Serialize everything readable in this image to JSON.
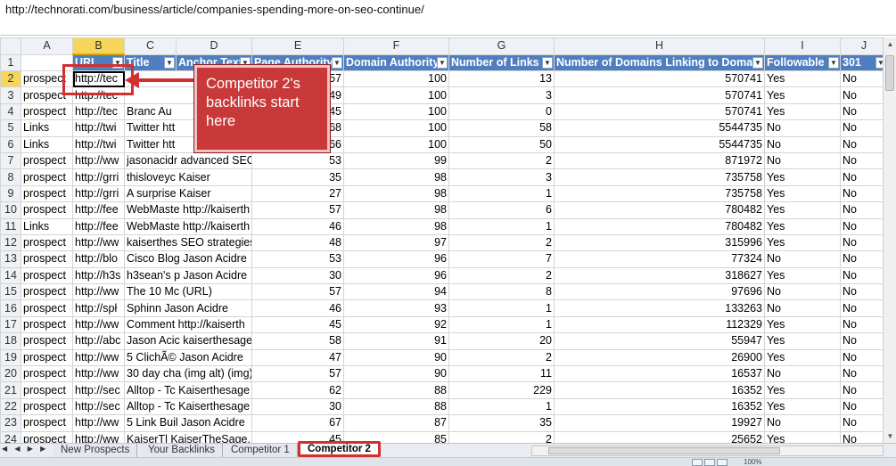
{
  "url": "http://technorati.com/business/article/companies-spending-more-on-seo-continue/",
  "columns": [
    "A",
    "B",
    "C",
    "D",
    "E",
    "F",
    "G",
    "H",
    "I",
    "J"
  ],
  "selected_column": "B",
  "selected_row": "2",
  "header_row": {
    "row": "1",
    "cells": [
      "",
      "URL",
      "Title",
      "Anchor Text",
      "Page Authority",
      "Domain Authority",
      "Number of Links",
      "Number of Domains Linking to Domain",
      "Followable",
      "301"
    ]
  },
  "rows": [
    [
      "2",
      "prospect",
      "http://tec",
      "",
      "57",
      "100",
      "13",
      "570741",
      "Yes",
      "No"
    ],
    [
      "3",
      "prospect",
      "http://tec",
      "",
      "49",
      "100",
      "3",
      "570741",
      "Yes",
      "No"
    ],
    [
      "4",
      "prospect",
      "http://tec",
      "Branc Au",
      "45",
      "100",
      "0",
      "570741",
      "Yes",
      "No"
    ],
    [
      "5",
      "Links",
      "http://twi",
      "Twitter htt",
      "68",
      "100",
      "58",
      "5544735",
      "No",
      "No"
    ],
    [
      "6",
      "Links",
      "http://twi",
      "Twitter htt",
      "66",
      "100",
      "50",
      "5544735",
      "No",
      "No"
    ],
    [
      "7",
      "prospect",
      "http://ww",
      "jasonacidr advanced SEO s",
      "53",
      "99",
      "2",
      "871972",
      "No",
      "No"
    ],
    [
      "8",
      "prospect",
      "http://grri",
      "thisloveyc Kaiser",
      "35",
      "98",
      "3",
      "735758",
      "Yes",
      "No"
    ],
    [
      "9",
      "prospect",
      "http://grri",
      "A surprise Kaiser",
      "27",
      "98",
      "1",
      "735758",
      "Yes",
      "No"
    ],
    [
      "10",
      "prospect",
      "http://fee",
      "WebMaste http://kaiserth",
      "57",
      "98",
      "6",
      "780482",
      "Yes",
      "No"
    ],
    [
      "11",
      "Links",
      "http://fee",
      "WebMaste http://kaiserth",
      "46",
      "98",
      "1",
      "780482",
      "Yes",
      "No"
    ],
    [
      "12",
      "prospect",
      "http://ww",
      "kaiserthes SEO strategies",
      "48",
      "97",
      "2",
      "315996",
      "Yes",
      "No"
    ],
    [
      "13",
      "prospect",
      "http://blo",
      "Cisco Blog Jason Acidre",
      "53",
      "96",
      "7",
      "77324",
      "No",
      "No"
    ],
    [
      "14",
      "prospect",
      "http://h3s",
      "h3sean's p Jason Acidre",
      "30",
      "96",
      "2",
      "318627",
      "Yes",
      "No"
    ],
    [
      "15",
      "prospect",
      "http://ww",
      "The 10 Mc (URL)",
      "57",
      "94",
      "8",
      "97696",
      "No",
      "No"
    ],
    [
      "16",
      "prospect",
      "http://spł",
      "Sphinn   Jason  Acidre",
      "46",
      "93",
      "1",
      "133263",
      "No",
      "No"
    ],
    [
      "17",
      "prospect",
      "http://ww",
      "Comment http://kaiserth",
      "45",
      "92",
      "1",
      "112329",
      "Yes",
      "No"
    ],
    [
      "18",
      "prospect",
      "http://abc",
      "Jason Acic kaiserthesage.c",
      "58",
      "91",
      "20",
      "55947",
      "Yes",
      "No"
    ],
    [
      "19",
      "prospect",
      "http://ww",
      "5 ClichÃ© Jason Acidre",
      "47",
      "90",
      "2",
      "26900",
      "Yes",
      "No"
    ],
    [
      "20",
      "prospect",
      "http://ww",
      "30 day cha (img alt) (img)",
      "57",
      "90",
      "11",
      "16537",
      "No",
      "No"
    ],
    [
      "21",
      "prospect",
      "http://sec",
      "Alltop - Tc Kaiserthesage",
      "62",
      "88",
      "229",
      "16352",
      "Yes",
      "No"
    ],
    [
      "22",
      "prospect",
      "http://sec",
      "Alltop - Tc Kaiserthesage",
      "30",
      "88",
      "1",
      "16352",
      "Yes",
      "No"
    ],
    [
      "23",
      "prospect",
      "http://ww",
      "5 Link Buil Jason Acidre",
      "67",
      "87",
      "35",
      "19927",
      "No",
      "No"
    ],
    [
      "24",
      "prospect",
      "http://ww",
      "   KaiserTl KaiserTheSage.",
      "45",
      "85",
      "2",
      "25652",
      "Yes",
      "No"
    ]
  ],
  "callout": {
    "text": "Competitor 2's backlinks start here"
  },
  "sheet_tabs": [
    "New Prospects",
    "Your Backlinks",
    "Competitor 1",
    "Competitor 2"
  ],
  "active_tab": "Competitor 2",
  "status": {
    "zoom": "100%"
  },
  "colors": {
    "header_fill": "#4f7fc0",
    "highlight_red": "#d22f2f",
    "callout_fill": "#c9393a",
    "selected_header": "#f5d65b"
  }
}
